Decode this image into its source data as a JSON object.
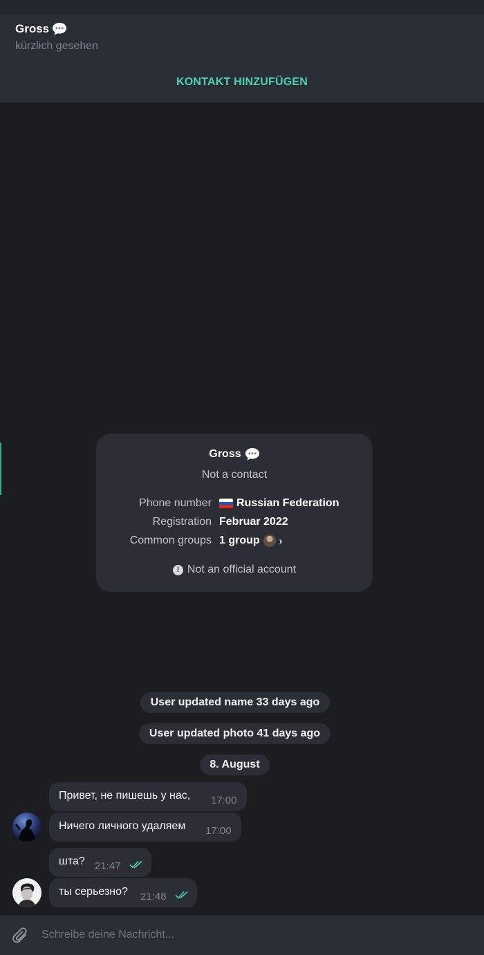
{
  "header": {
    "name": "Gross",
    "status": "kürzlich gesehen",
    "add_contact": "KONTAKT HINZUFÜGEN"
  },
  "info_card": {
    "name": "Gross",
    "subtitle": "Not a contact",
    "rows": [
      {
        "label": "Phone number",
        "value": "Russian Federation"
      },
      {
        "label": "Registration",
        "value": "Februar 2022"
      },
      {
        "label": "Common groups",
        "value": "1 group"
      }
    ],
    "official_note": "Not an official account"
  },
  "service_messages": [
    "User updated name 33 days ago",
    "User updated photo 41 days ago",
    "8. August"
  ],
  "messages": [
    {
      "text": "Привет, не пишешь  у нас,",
      "time": "17:00",
      "sent": false
    },
    {
      "text": "Ничего личного удаляем",
      "time": "17:00",
      "sent": false
    },
    {
      "text": "шта?",
      "time": "21:47",
      "sent": true
    },
    {
      "text": "ты серьезно?",
      "time": "21:48",
      "sent": true
    }
  ],
  "composer": {
    "placeholder": "Schreibe deine Nachricht..."
  },
  "colors": {
    "accent": "#4fd1b5",
    "background": "#1b1d21",
    "bubble": "#2b2f35",
    "header": "#292d34"
  },
  "icons": [
    "speech-bubble-icon",
    "russia-flag-icon",
    "group-avatar-icon",
    "chevron-right-icon",
    "exclamation-icon",
    "double-check-icon",
    "paperclip-icon"
  ]
}
